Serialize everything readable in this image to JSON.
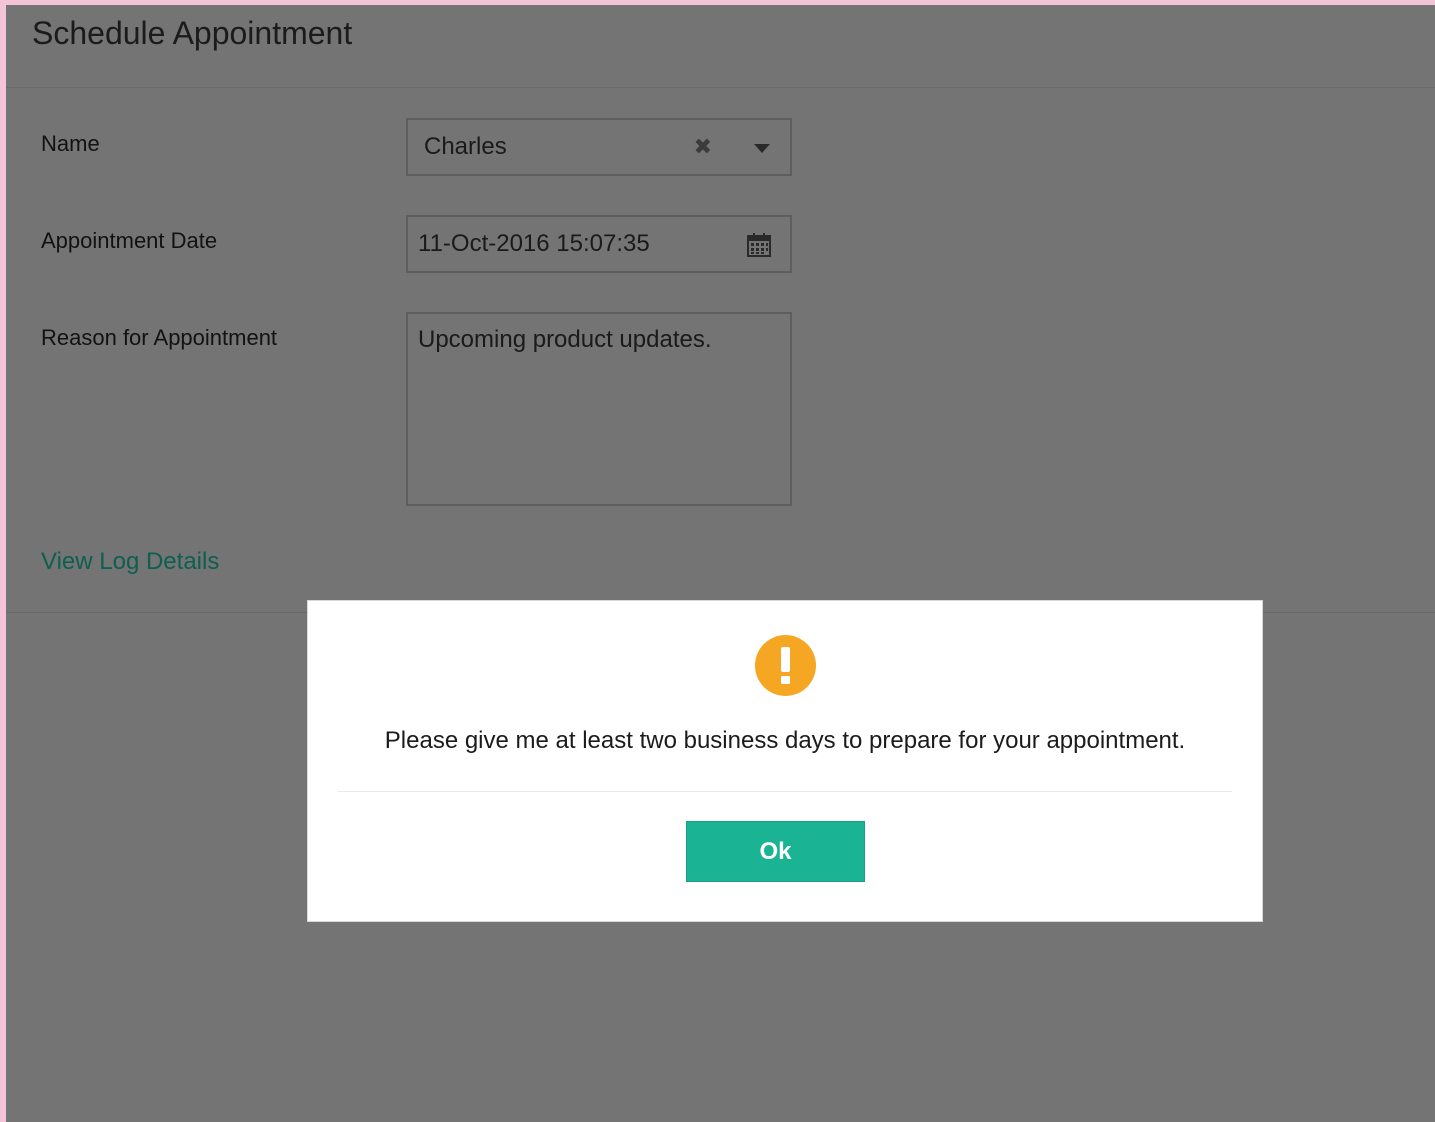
{
  "header": {
    "title": "Schedule Appointment"
  },
  "form": {
    "name": {
      "label": "Name",
      "value": "Charles",
      "clear_glyph": "✖"
    },
    "date": {
      "label": "Appointment Date",
      "value": "11-Oct-2016 15:07:35"
    },
    "reason": {
      "label": "Reason for Appointment",
      "value": "Upcoming product updates."
    },
    "log_link": "View Log Details"
  },
  "dialog": {
    "icon": "exclamation-circle-icon",
    "message": "Please give me at least two business days to prepare for your appointment.",
    "ok_label": "Ok"
  },
  "colors": {
    "overlay": "#747474",
    "accent": "#1ab394",
    "warning": "#f5a623",
    "link": "#0d5f4f"
  }
}
